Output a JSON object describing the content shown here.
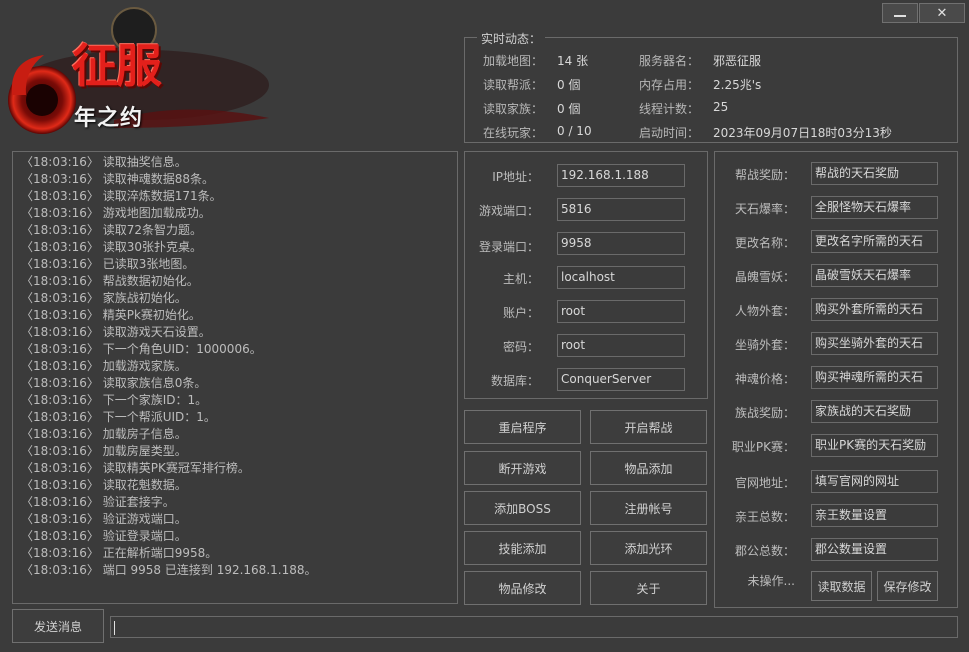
{
  "window": {
    "minimize_label": "▁",
    "close_label": "✕"
  },
  "logo": {
    "title": "征服",
    "subtitle": "年之约"
  },
  "status": {
    "group_title": "实时动态：",
    "rows": [
      {
        "label": "加载地图：",
        "value": "14 张",
        "label2": "服务器名：",
        "value2": "邪恶征服"
      },
      {
        "label": "读取帮派：",
        "value": "0 個",
        "label2": "内存占用：",
        "value2": "2.25兆's"
      },
      {
        "label": "读取家族：",
        "value": "0 個",
        "label2": "线程计数：",
        "value2": "25"
      },
      {
        "label": "在线玩家：",
        "value": "0 / 10",
        "label2": "启动时间：",
        "value2": "2023年09月07日18时03分13秒"
      }
    ]
  },
  "log": [
    "〈18:03:16〉 读取抽奖信息。",
    "〈18:03:16〉 读取神魂数据88条。",
    "〈18:03:16〉 读取淬炼数据171条。",
    "〈18:03:16〉 游戏地图加载成功。",
    "〈18:03:16〉 读取72条智力题。",
    "〈18:03:16〉 读取30张扑克桌。",
    "〈18:03:16〉 已读取3张地图。",
    "〈18:03:16〉 帮战数据初始化。",
    "〈18:03:16〉 家族战初始化。",
    "〈18:03:16〉 精英Pk赛初始化。",
    "〈18:03:16〉 读取游戏天石设置。",
    "〈18:03:16〉 下一个角色UID：1000006。",
    "〈18:03:16〉 加载游戏家族。",
    "〈18:03:16〉 读取家族信息0条。",
    "〈18:03:16〉 下一个家族ID：1。",
    "〈18:03:16〉 下一个帮派UID：1。",
    "〈18:03:16〉 加载房子信息。",
    "〈18:03:16〉 加载房屋类型。",
    "〈18:03:16〉 读取精英PK赛冠军排行榜。",
    "〈18:03:16〉 读取花魁数据。",
    "〈18:03:16〉 验证套接字。",
    "〈18:03:16〉 验证游戏端口。",
    "〈18:03:16〉 验证登录端口。",
    "〈18:03:16〉 正在解析端口9958。",
    "〈18:03:16〉 端口 9958 已连接到 192.168.1.188。"
  ],
  "config": {
    "ip_label": "IP地址：",
    "ip_value": "192.168.1.188",
    "game_port_label": "游戏端口：",
    "game_port_value": "5816",
    "login_port_label": "登录端口：",
    "login_port_value": "9958",
    "host_label": "主机：",
    "host_value": "localhost",
    "account_label": "账户：",
    "account_value": "root",
    "password_label": "密码：",
    "password_value": "root",
    "database_label": "数据库：",
    "database_value": "ConquerServer"
  },
  "actions": {
    "restart": "重启程序",
    "open_guild_war": "开启帮战",
    "disconnect": "断开游戏",
    "add_item": "物品添加",
    "add_boss": "添加BOSS",
    "register": "注册帐号",
    "add_skill": "技能添加",
    "add_halo": "添加光环",
    "edit_item": "物品修改",
    "about": "关于"
  },
  "settings": {
    "rows": [
      {
        "label": "帮战奖励：",
        "value": "帮战的天石奖励"
      },
      {
        "label": "天石爆率：",
        "value": "全服怪物天石爆率"
      },
      {
        "label": "更改名称：",
        "value": "更改名字所需的天石"
      },
      {
        "label": "晶魄雪妖：",
        "value": "晶破雪妖天石爆率"
      },
      {
        "label": "人物外套：",
        "value": "购买外套所需的天石"
      },
      {
        "label": "坐骑外套：",
        "value": "购买坐骑外套的天石"
      },
      {
        "label": "神魂价格：",
        "value": "购买神魂所需的天石"
      },
      {
        "label": "族战奖励：",
        "value": "家族战的天石奖励"
      },
      {
        "label": "职业PK赛：",
        "value": "职业PK赛的天石奖励"
      },
      {
        "label": "官网地址：",
        "value": "填写官网的网址"
      },
      {
        "label": "亲王总数：",
        "value": "亲王数量设置"
      },
      {
        "label": "郡公总数：",
        "value": "郡公数量设置"
      }
    ],
    "status_text": "未操作...",
    "read_button": "读取数据",
    "save_button": "保存修改"
  },
  "bottom": {
    "send_button": "发送消息",
    "message_value": ""
  }
}
